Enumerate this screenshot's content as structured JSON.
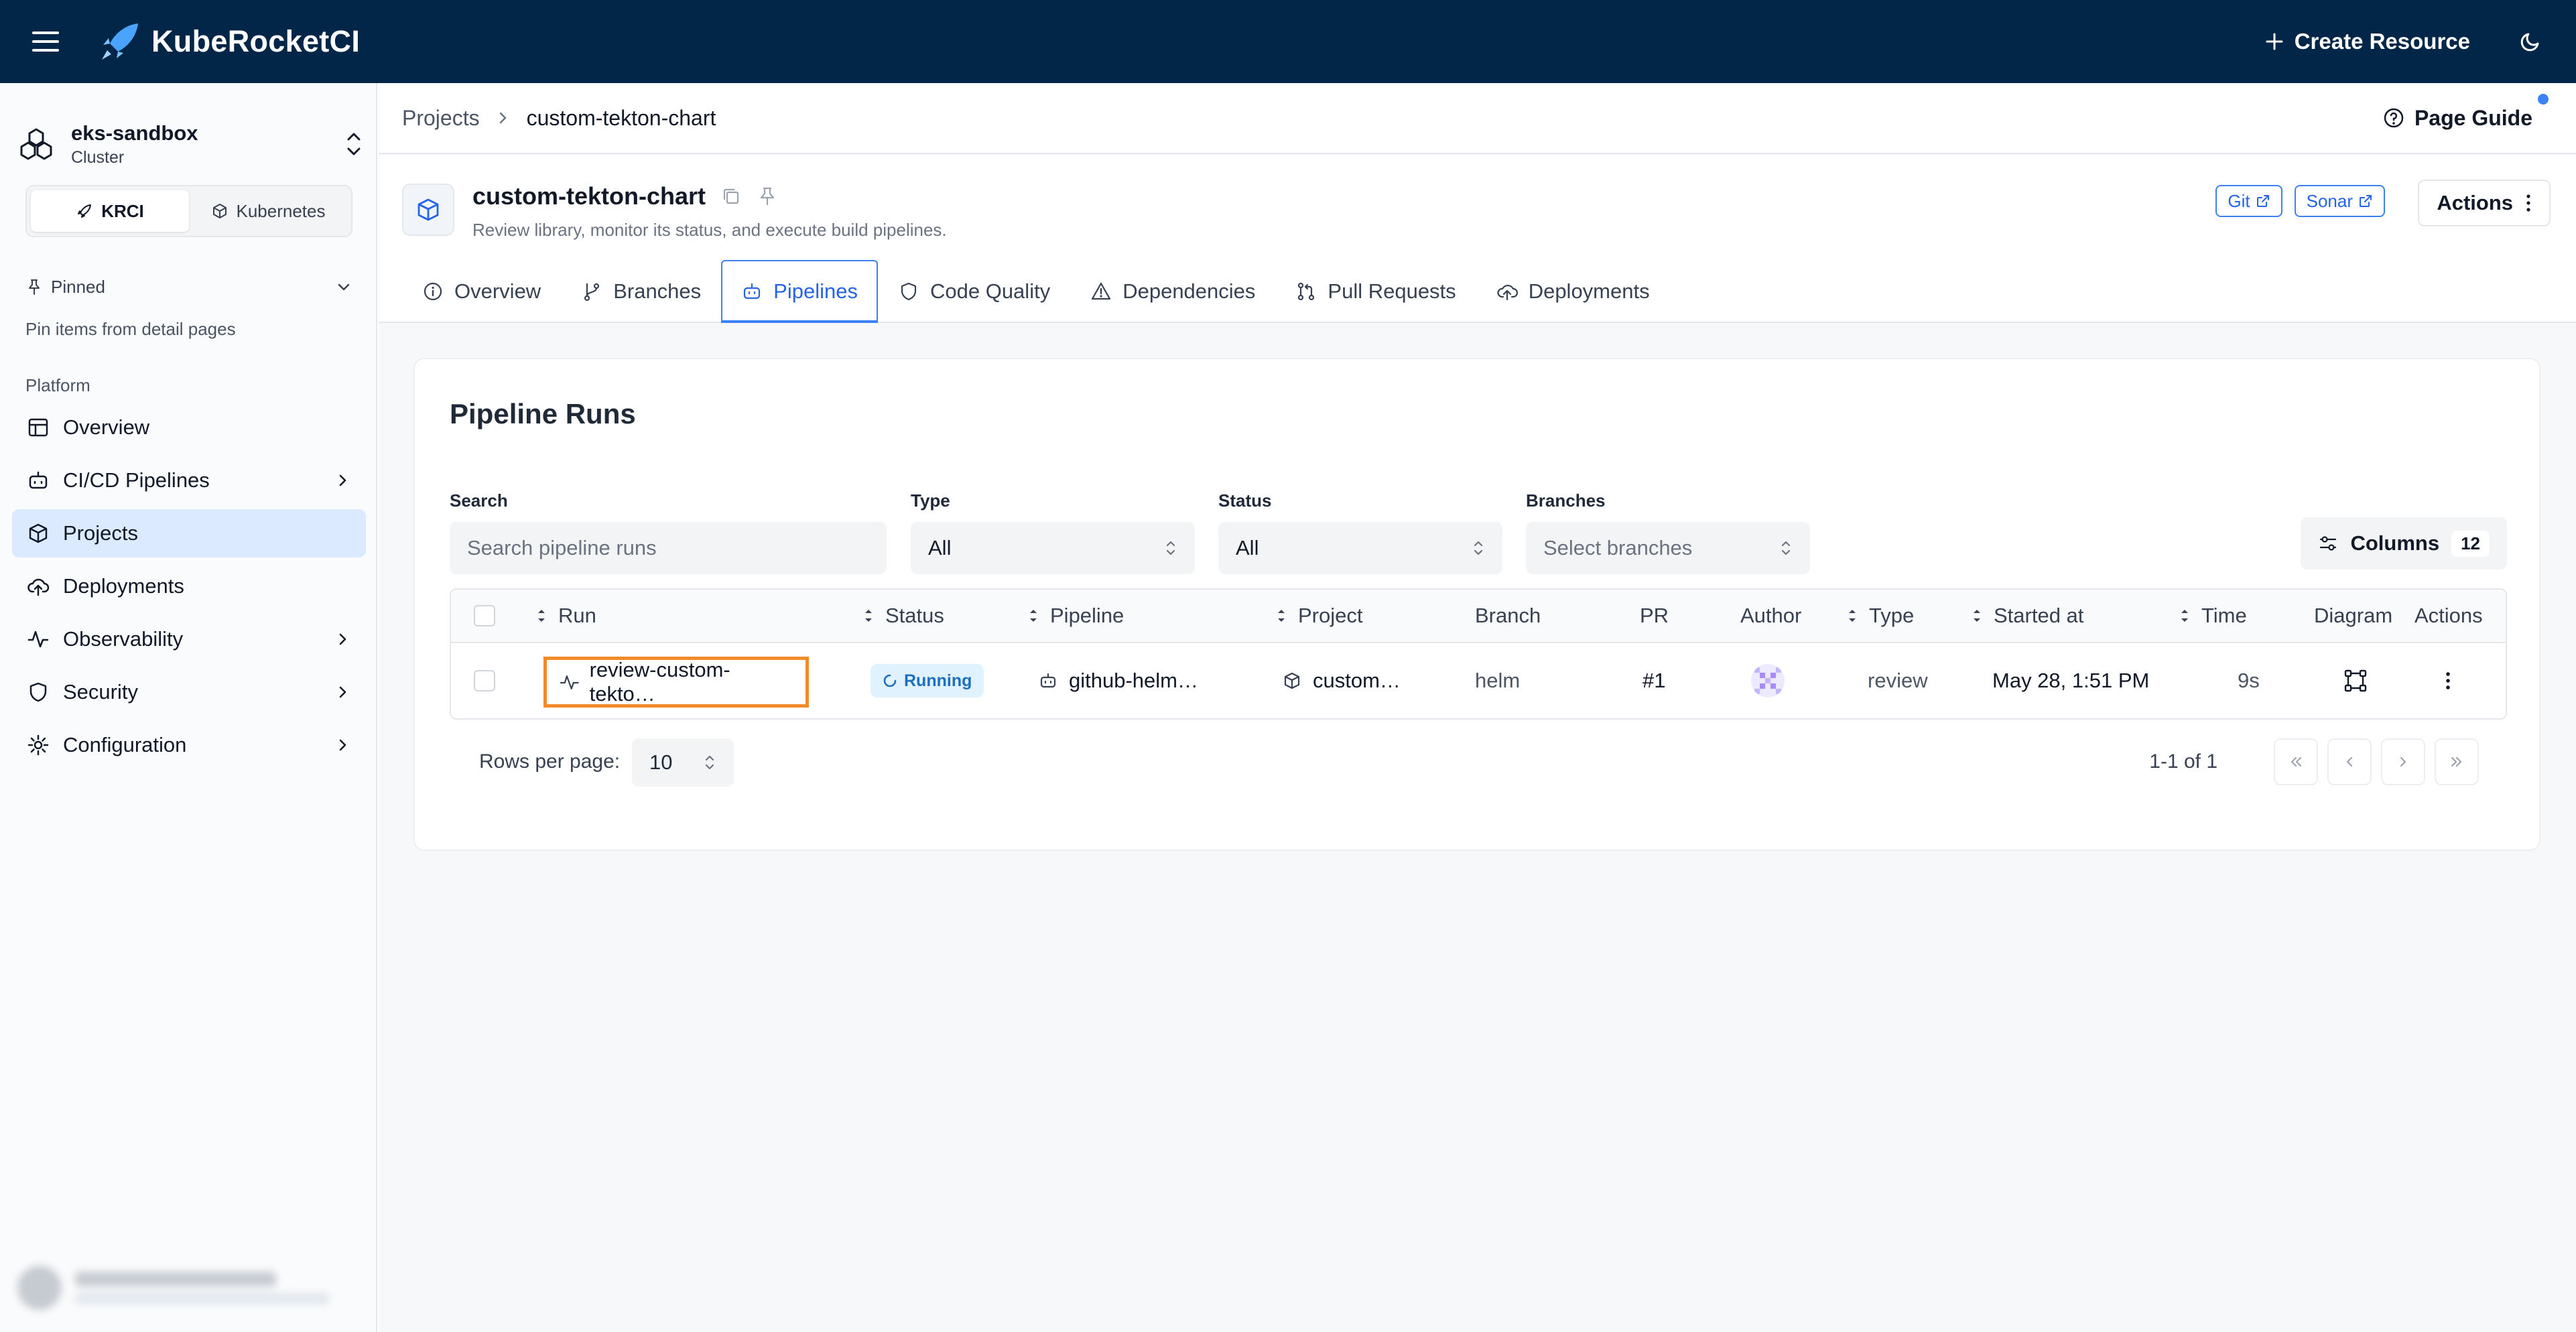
{
  "app": {
    "title": "KubeRocketCI",
    "create_label": "Create Resource"
  },
  "sidebar": {
    "cluster_name": "eks-sandbox",
    "cluster_type": "Cluster",
    "modes": [
      {
        "label": "KRCI",
        "active": true
      },
      {
        "label": "Kubernetes",
        "active": false
      }
    ],
    "pinned_label": "Pinned",
    "pinned_hint": "Pin items from detail pages",
    "section_label": "Platform",
    "items": [
      {
        "label": "Overview",
        "icon": "layout-icon"
      },
      {
        "label": "CI/CD Pipelines",
        "icon": "bot-icon"
      },
      {
        "label": "Projects",
        "icon": "box-icon"
      },
      {
        "label": "Deployments",
        "icon": "cloud-upload-icon"
      },
      {
        "label": "Observability",
        "icon": "activity-icon"
      },
      {
        "label": "Security",
        "icon": "shield-icon"
      },
      {
        "label": "Configuration",
        "icon": "gear-icon"
      }
    ]
  },
  "breadcrumbs": {
    "parent": "Projects",
    "current": "custom-tekton-chart"
  },
  "page_guide_label": "Page Guide",
  "header": {
    "title": "custom-tekton-chart",
    "description": "Review library, monitor its status, and execute build pipelines.",
    "links": {
      "git": "Git",
      "sonar": "Sonar"
    },
    "actions_label": "Actions"
  },
  "tabs": [
    {
      "label": "Overview",
      "icon": "info-icon"
    },
    {
      "label": "Branches",
      "icon": "git-branch-icon"
    },
    {
      "label": "Pipelines",
      "icon": "bot-icon",
      "active": true
    },
    {
      "label": "Code Quality",
      "icon": "shield-icon"
    },
    {
      "label": "Dependencies",
      "icon": "alert-triangle-icon"
    },
    {
      "label": "Pull Requests",
      "icon": "git-pull-request-icon"
    },
    {
      "label": "Deployments",
      "icon": "cloud-upload-icon"
    }
  ],
  "pipeline_runs": {
    "title": "Pipeline Runs",
    "filters": {
      "search_label": "Search",
      "search_placeholder": "Search pipeline runs",
      "type_label": "Type",
      "type_value": "All",
      "status_label": "Status",
      "status_value": "All",
      "branches_label": "Branches",
      "branches_placeholder": "Select branches"
    },
    "columns_label": "Columns",
    "columns_count": "12",
    "headers": {
      "run": "Run",
      "status": "Status",
      "pipeline": "Pipeline",
      "project": "Project",
      "branch": "Branch",
      "pr": "PR",
      "author": "Author",
      "type": "Type",
      "started": "Started at",
      "time": "Time",
      "diagram": "Diagram",
      "actions": "Actions"
    },
    "rows": [
      {
        "run": "review-custom-tekto…",
        "status": "Running",
        "pipeline": "github-helm…",
        "project": "custom…",
        "branch": "helm",
        "pr": "#1",
        "type": "review",
        "started": "May 28, 1:51 PM",
        "time": "9s"
      }
    ],
    "rows_per_page_label": "Rows per page:",
    "rows_per_page": "10",
    "range": "1-1 of 1"
  },
  "colors": {
    "topbar": "#022648",
    "accent": "#3b82f6",
    "highlight": "#f28a2a"
  }
}
